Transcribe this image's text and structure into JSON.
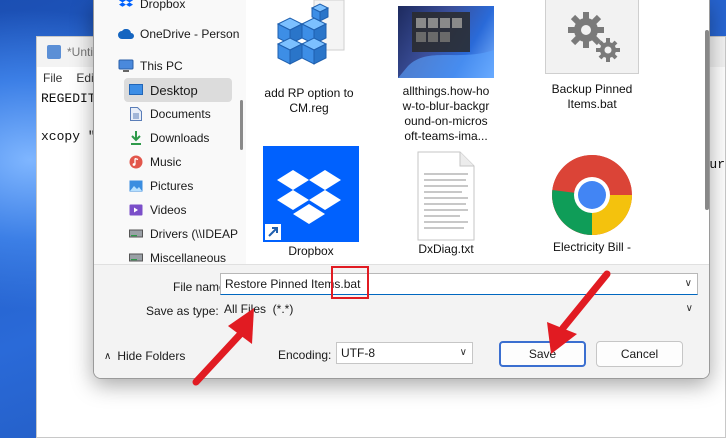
{
  "notepad": {
    "title": "*Unti",
    "menu": [
      "File",
      "Edit"
    ],
    "lines": [
      "REGEDIT",
      "xcopy \""
    ],
    "right_fragment": "aur"
  },
  "nav": {
    "items": [
      {
        "label": "Dropbox",
        "icon": "dropbox-icon"
      },
      {
        "label": "OneDrive - Person",
        "icon": "cloud-icon"
      },
      {
        "label": "This PC",
        "icon": "computer-icon"
      },
      {
        "label": "Desktop",
        "icon": "desktop-icon"
      },
      {
        "label": "Documents",
        "icon": "documents-icon"
      },
      {
        "label": "Downloads",
        "icon": "download-icon"
      },
      {
        "label": "Music",
        "icon": "music-icon"
      },
      {
        "label": "Pictures",
        "icon": "pictures-icon"
      },
      {
        "label": "Videos",
        "icon": "videos-icon"
      },
      {
        "label": "Drivers (\\\\IDEAP",
        "icon": "drive-icon"
      },
      {
        "label": "Miscellaneous",
        "icon": "drive-icon"
      }
    ]
  },
  "files": [
    {
      "name": "add RP option to CM.reg",
      "label_lines": [
        "add RP option to",
        "CM.reg"
      ],
      "icon": "registry-icon"
    },
    {
      "name": "allthings.how-how-to-blur-background-on-microsoft-teams-ima...",
      "label_lines": [
        "allthings.how-ho",
        "w-to-blur-backgr",
        "ound-on-micros",
        "oft-teams-ima..."
      ],
      "icon": "image-thumbnail"
    },
    {
      "name": "Backup Pinned Items.bat",
      "label_lines": [
        "Backup Pinned",
        "Items.bat"
      ],
      "icon": "gear-icon"
    },
    {
      "name": "Dropbox",
      "label_lines": [
        "Dropbox"
      ],
      "icon": "dropbox-icon"
    },
    {
      "name": "DxDiag.txt",
      "label_lines": [
        "DxDiag.txt"
      ],
      "icon": "text-file-icon"
    },
    {
      "name": "Electricity Bill -",
      "label_lines": [
        "Electricity Bill -"
      ],
      "icon": "chrome-icon"
    }
  ],
  "form": {
    "file_name_label": "File name:",
    "file_name_value": "Restore Pinned Items.bat",
    "save_type_label": "Save as type:",
    "save_type_value": "All Files  (*.*)",
    "hide_folders_label": "Hide Folders",
    "encoding_label": "Encoding:",
    "encoding_value": "UTF-8",
    "save_label": "Save",
    "cancel_label": "Cancel"
  },
  "colors": {
    "accent": "#0067c0",
    "annotation": "#e11b22",
    "dropbox": "#0061fe"
  }
}
